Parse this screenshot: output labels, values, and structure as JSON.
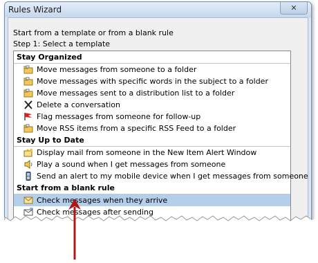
{
  "window": {
    "title": "Rules Wizard",
    "close_label": "✕"
  },
  "intro": "Start from a template or from a blank rule",
  "step": "Step 1: Select a template",
  "groups": [
    {
      "title": "Stay Organized",
      "items": [
        {
          "label": "Move messages from someone to a folder",
          "icon": "folder-move-icon"
        },
        {
          "label": "Move messages with specific words in the subject to a folder",
          "icon": "folder-move-icon"
        },
        {
          "label": "Move messages sent to a distribution list to a folder",
          "icon": "folder-move-icon"
        },
        {
          "label": "Delete a conversation",
          "icon": "delete-x-icon"
        },
        {
          "label": "Flag messages from someone for follow-up",
          "icon": "red-flag-icon"
        },
        {
          "label": "Move RSS items from a specific RSS Feed to a folder",
          "icon": "folder-move-icon"
        }
      ]
    },
    {
      "title": "Stay Up to Date",
      "items": [
        {
          "label": "Display mail from someone in the New Item Alert Window",
          "icon": "alert-window-icon"
        },
        {
          "label": "Play a sound when I get messages from someone",
          "icon": "speaker-icon"
        },
        {
          "label": "Send an alert to my mobile device when I get messages from someone",
          "icon": "mobile-phone-icon"
        }
      ]
    },
    {
      "title": "Start from a blank rule",
      "items": [
        {
          "label": "Check messages when they arrive",
          "icon": "envelope-icon",
          "selected": true
        },
        {
          "label": "Check messages after sending",
          "icon": "sent-mail-icon"
        }
      ]
    }
  ],
  "colors": {
    "selection": "#b4cfea",
    "arrow": "#b01818",
    "flag": "#d92020"
  }
}
